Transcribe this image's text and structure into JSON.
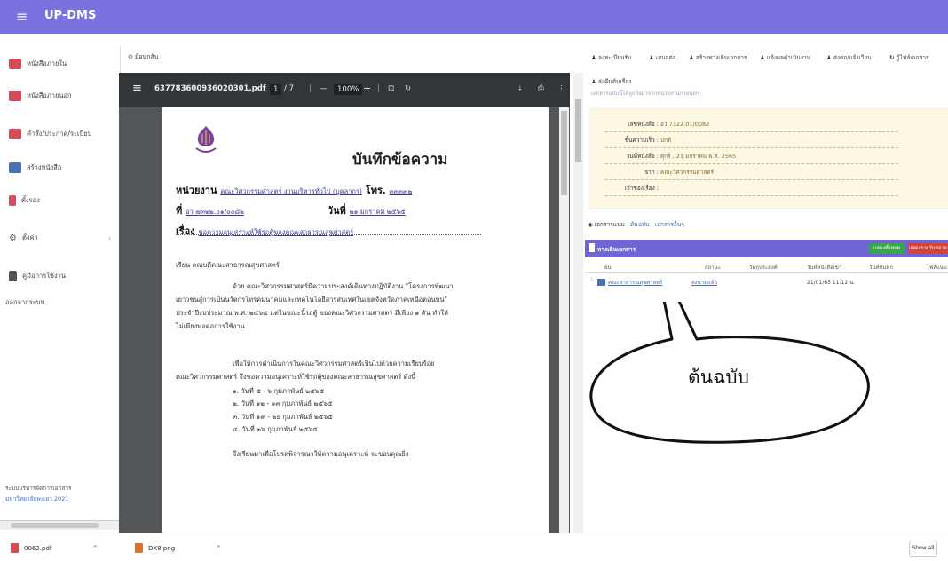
{
  "app": {
    "title": "UP-DMS"
  },
  "sidebar": {
    "items": [
      {
        "label": "หนังสือภายใน",
        "color": "#d24d57"
      },
      {
        "label": "หนังสือภายนอก",
        "color": "#d24d57"
      },
      {
        "label": "คำสั่ง/ประกาศ/ระเบียบ",
        "color": "#d24d57"
      },
      {
        "label": "สร้างหนังสือ",
        "color": "#4a6fb5"
      },
      {
        "label": "ตั้งรอง",
        "color": "#d24d57"
      },
      {
        "label": "ตั้งค่า",
        "color": "#666666"
      },
      {
        "label": "คู่มือการใช้งาน",
        "color": "#555555"
      },
      {
        "label": "ออกจากระบบ",
        "color": "#555555"
      }
    ],
    "footer_line1": "ระบบบริหารจัดการเอกสาร",
    "footer_line2": "มหาวิทยาลัยพะเยา 2021"
  },
  "back_label": "ย้อนกลับ",
  "pdf": {
    "filename": "637783600936020301.pdf",
    "page": "1",
    "pages": "/ 7",
    "zoom": "100%",
    "title": "บันทึกข้อความ",
    "agency_label": "หน่วยงาน",
    "agency_value": "คณะวิศวกรรมศาสตร์ งานบริหารทั่วไป (บุคลากร)",
    "phone_label": "โทร.",
    "phone_value": "๓๓๓๙๒",
    "ref_label": "ที่",
    "ref_value": "อว ๗๓๒๒.๐๑/๐๐๘๒",
    "date_label": "วันที่",
    "date_value": "๒๑ มกราคม ๒๕๖๕",
    "subject_label": "เรื่อง",
    "subject_value": "ขอความอนุเคราะห์ใช้รถตู้ของคณะสาธารณสุขศาสตร์",
    "greeting": "เรียน  คณบดีคณะสาธารณสุขศาสตร์",
    "para1_l1": "ด้วย คณะวิศวกรรมศาสตร์มีความประสงค์เดินทางปฏิบัติงาน \"โครงการพัฒนา",
    "para1_l2": "เยาวชนสู่การเป็นนวัตกรโทรคมนาคมและเทคโนโลยีสารสนเทศในเขตจังหวัดภาคเหนือตอนบน\"",
    "para1_l3": "ประจำปีงบประมาณ พ.ศ. ๒๕๖๕ แต่ในขณะนี้รถตู้ ของคณะวิศวกรรมศาสตร์ มีเพียง ๑ คัน ทำให้",
    "para1_l4": "ไม่เพียงพอต่อการใช้งาน",
    "para2_l1": "เพื่อให้การดำเนินการในคณะวิศวกรรมศาสตร์เป็นไปด้วยความเรียบร้อย",
    "para2_l2": "คณะวิศวกรรมศาสตร์ จึงขอความอนุเคราะห์ใช้รถตู้ของคณะสาธารณสุขศาสตร์ ดังนี้",
    "list": [
      "๑. วันที่ ๕ - ๖ กุมภาพันธ์ ๒๕๖๕",
      "๒. วันที่ ๑๒ - ๑๓ กุมภาพันธ์ ๒๕๖๕",
      "๓. วันที่ ๑๙ - ๒๐ กุมภาพันธ์ ๒๕๖๕",
      "๔. วันที่ ๒๖ กุมภาพันธ์ ๒๕๖๕"
    ],
    "closing": "จึงเรียนมาเพื่อโปรดพิจารณาให้ความอนุเคราะห์ จะขอบคุณยิ่ง"
  },
  "toolbar": {
    "items": [
      "ลงทะเบียนรับ",
      "เสนอต่อ",
      "สร้างทางเดินเอกสาร",
      "แจ้งผลดำเนินงาน",
      "ส่งต่อ/แจ้งเวียน",
      "กู้ไฟล์เอกสาร"
    ],
    "second": "ส่งคืนต้นเรื่อง"
  },
  "info": {
    "hint": "เอกสารฉบับนี้ได้ถูกส่งมาจากหน่วยงานภายนอก",
    "rows": [
      {
        "label": "เลขหนังสือ :",
        "value": "อว 7322.01/0082"
      },
      {
        "label": "ชั้นความเร็ว :",
        "value": "ปกติ"
      },
      {
        "label": "วันที่หนังสือ :",
        "value": "ศุกร์ , 21 มกราคม พ.ศ. 2565"
      },
      {
        "label": "จาก :",
        "value": "คณะวิศวกรรมศาสตร์"
      },
      {
        "label": "เจ้าของเรื่อง :",
        "value": ""
      }
    ]
  },
  "refs": {
    "label": "เอกสารแนบ - ",
    "original": "ต้นฉบับ",
    "sep": " | ",
    "others": "เอกสารอื่นๆ"
  },
  "table": {
    "title": "ทางเดินเอกสาร",
    "btn_green": "แสดงทั้งหมด",
    "btn_red": "แสดงรายวันหน่วย",
    "headers": [
      "ผ้น",
      "สถานะ",
      "วัตถุประสงค์",
      "วันที่หนังสือเข้า",
      "วันที่บันทึก",
      "ไฟล์แนบ"
    ],
    "row": {
      "name": "คณะสาธารณสุขศาสตร์",
      "status": "ลงนามแล้ว",
      "date": "21/01/65 11:12 น."
    }
  },
  "callout": "ต้นฉบับ",
  "downloads": [
    {
      "name": "0062.pdf",
      "color": "#d24d57"
    },
    {
      "name": "DX8.png",
      "color": "#e0702a"
    }
  ],
  "show_all": "Show all"
}
